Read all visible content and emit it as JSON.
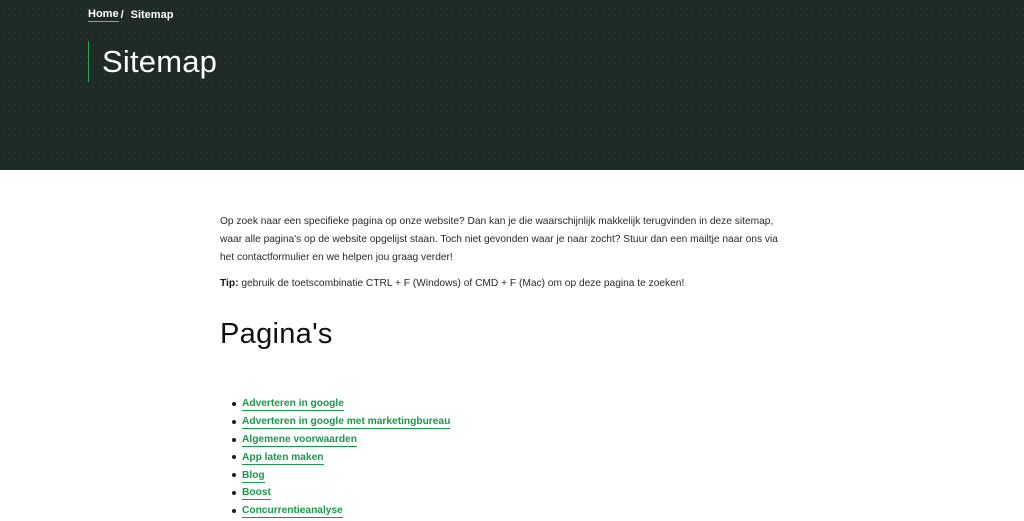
{
  "breadcrumb": {
    "home": "Home",
    "separator": "/",
    "current": "Sitemap"
  },
  "header": {
    "title": "Sitemap"
  },
  "intro": {
    "text": "Op zoek naar een specifieke pagina op onze website? Dan kan je die waarschijnlijk makkelijk terugvinden in deze sitemap, waar alle pagina's op de website opgelijst staan. Toch niet gevonden waar je naar zocht? Stuur dan een mailtje naar ons via het contactformulier en we helpen jou graag verder!",
    "tip_label": "Tip:",
    "tip_text": " gebruik de toetscombinatie CTRL + F (Windows) of CMD + F (Mac) om op deze pagina te zoeken!"
  },
  "pages_section": {
    "title": "Pagina's",
    "items": [
      "Adverteren in google",
      "Adverteren in google met marketingbureau",
      "Algemene voorwaarden",
      "App laten maken",
      "Blog",
      "Boost",
      "Concurrentieanalyse"
    ]
  },
  "colors": {
    "hero_bg": "#1e2b25",
    "accent_green": "#199a4a",
    "text": "#1d1d1d"
  }
}
